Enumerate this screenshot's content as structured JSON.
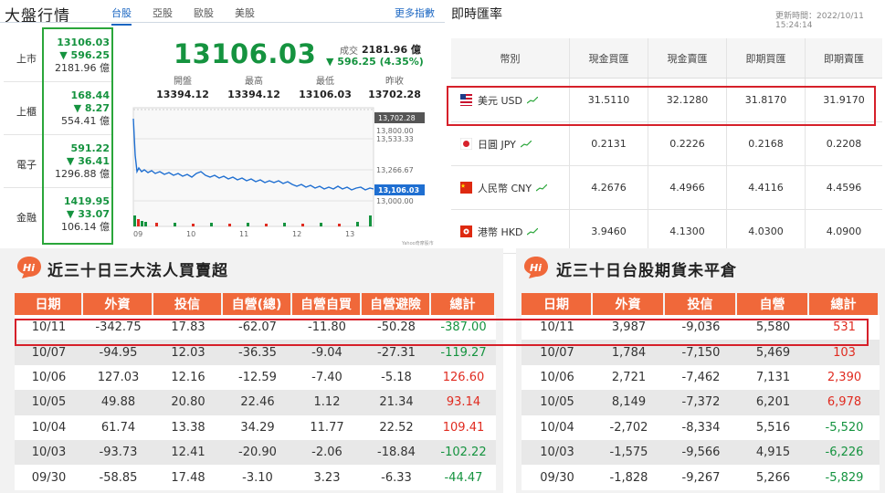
{
  "market": {
    "title": "大盤行情",
    "tabs": [
      "台股",
      "亞股",
      "歐股",
      "美股"
    ],
    "more": "更多指數",
    "indices": [
      {
        "name": "上市",
        "price": "13106.03",
        "change": "▼ 596.25",
        "volume": "2181.96 億"
      },
      {
        "name": "上櫃",
        "price": "168.44",
        "change": "▼ 8.27",
        "volume": "554.41 億"
      },
      {
        "name": "電子",
        "price": "591.22",
        "change": "▼ 36.41",
        "volume": "1296.88 億"
      },
      {
        "name": "金融",
        "price": "1419.95",
        "change": "▼ 33.07",
        "volume": "106.14 億"
      }
    ],
    "current": "13106.03",
    "volume_label": "成交",
    "volume": "2181.96 億",
    "change": "▼ 596.25 (4.35%)",
    "stats": [
      {
        "label": "開盤",
        "value": "13394.12"
      },
      {
        "label": "最高",
        "value": "13394.12"
      },
      {
        "label": "最低",
        "value": "13106.03"
      },
      {
        "label": "昨收",
        "value": "13702.28"
      }
    ],
    "chart": {
      "y_ticks": [
        "13,800.00",
        "13,533.33",
        "13,266.67",
        "13,000.00"
      ],
      "x_ticks": [
        "09",
        "10",
        "11",
        "12",
        "13"
      ],
      "prev_close_tag": "13,702.28",
      "last_tag": "13,106.03",
      "source": "Yahoo奇摩股市"
    }
  },
  "forex": {
    "title": "即時匯率",
    "updated": "更新時間：2022/10/11 15:24:14",
    "headers": [
      "幣別",
      "現金買匯",
      "現金賣匯",
      "即期買匯",
      "即期賣匯"
    ],
    "rows": [
      {
        "flag": "us-flag-icon",
        "name": "美元 USD",
        "cash_buy": "31.5110",
        "cash_sell": "32.1280",
        "spot_buy": "31.8170",
        "spot_sell": "31.9170"
      },
      {
        "flag": "jp-flag-icon",
        "name": "日圓 JPY",
        "cash_buy": "0.2131",
        "cash_sell": "0.2226",
        "spot_buy": "0.2168",
        "spot_sell": "0.2208"
      },
      {
        "flag": "cn-flag-icon",
        "name": "人民幣 CNY",
        "cash_buy": "4.2676",
        "cash_sell": "4.4966",
        "spot_buy": "4.4116",
        "spot_sell": "4.4596"
      },
      {
        "flag": "hk-flag-icon",
        "name": "港幣 HKD",
        "cash_buy": "3.9460",
        "cash_sell": "4.1300",
        "spot_buy": "4.0300",
        "spot_sell": "4.0900"
      }
    ]
  },
  "institutional": {
    "badge": "Hi",
    "title": "近三十日三大法人買賣超",
    "headers": [
      "日期",
      "外資",
      "投信",
      "自營(總)",
      "自營自買",
      "自營避險",
      "總計"
    ],
    "rows": [
      [
        "10/11",
        "-342.75",
        "17.83",
        "-62.07",
        "-11.80",
        "-50.28",
        "-387.00"
      ],
      [
        "10/07",
        "-94.95",
        "12.03",
        "-36.35",
        "-9.04",
        "-27.31",
        "-119.27"
      ],
      [
        "10/06",
        "127.03",
        "12.16",
        "-12.59",
        "-7.40",
        "-5.18",
        "126.60"
      ],
      [
        "10/05",
        "49.88",
        "20.80",
        "22.46",
        "1.12",
        "21.34",
        "93.14"
      ],
      [
        "10/04",
        "61.74",
        "13.38",
        "34.29",
        "11.77",
        "22.52",
        "109.41"
      ],
      [
        "10/03",
        "-93.73",
        "12.41",
        "-20.90",
        "-2.06",
        "-18.84",
        "-102.22"
      ],
      [
        "09/30",
        "-58.85",
        "17.48",
        "-3.10",
        "3.23",
        "-6.33",
        "-44.47"
      ]
    ]
  },
  "futures": {
    "badge": "Hi",
    "title": "近三十日台股期貨未平倉",
    "headers": [
      "日期",
      "外資",
      "投信",
      "自營",
      "總計"
    ],
    "rows": [
      [
        "10/11",
        "3,987",
        "-9,036",
        "5,580",
        "531"
      ],
      [
        "10/07",
        "1,784",
        "-7,150",
        "5,469",
        "103"
      ],
      [
        "10/06",
        "2,721",
        "-7,462",
        "7,131",
        "2,390"
      ],
      [
        "10/05",
        "8,149",
        "-7,372",
        "6,201",
        "6,978"
      ],
      [
        "10/04",
        "-2,702",
        "-8,334",
        "5,516",
        "-5,520"
      ],
      [
        "10/03",
        "-1,575",
        "-9,566",
        "4,915",
        "-6,226"
      ],
      [
        "09/30",
        "-1,828",
        "-9,267",
        "5,266",
        "-5,829"
      ]
    ]
  },
  "colors": {
    "up": "#e02b20",
    "down": "#15933f",
    "header": "#f0683a",
    "highlight": "#d6202a",
    "accent": "#1a66c2"
  }
}
